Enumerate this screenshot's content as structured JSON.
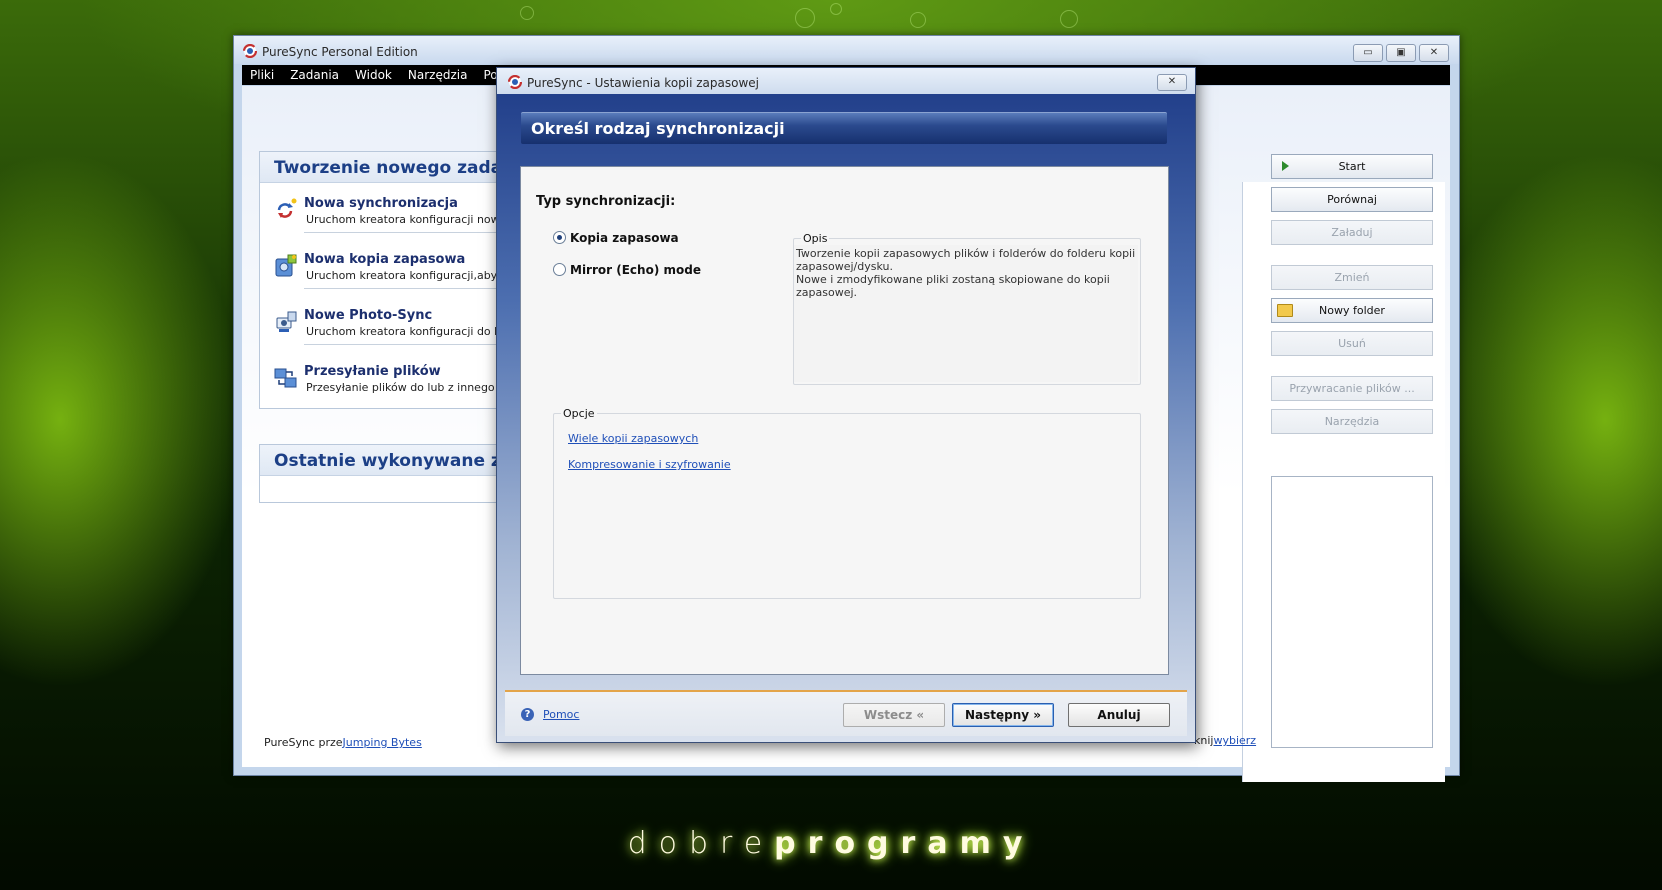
{
  "main_window": {
    "title": "PureSync Personal Edition",
    "menu": [
      "Pliki",
      "Zadania",
      "Widok",
      "Narzędzia",
      "Pomoc"
    ],
    "controls": {
      "minimize": "▭",
      "restore": "▣",
      "close": "✕"
    }
  },
  "create_panel": {
    "title": "Tworzenie nowego zadania",
    "tasks": [
      {
        "title": "Nowa synchronizacja",
        "desc": "Uruchom kreatora konfiguracji nowej sy"
      },
      {
        "title": "Nowa kopia zapasowa",
        "desc": "Uruchom kreatora konfiguracji,aby sko"
      },
      {
        "title": "Nowe Photo-Sync",
        "desc": "Uruchom kreatora konfiguracji do kopio"
      },
      {
        "title": "Przesyłanie plików",
        "desc": "Przesyłanie plików do lub z innego kom"
      }
    ]
  },
  "recent_panel": {
    "title": "Ostatnie wykonywane zada"
  },
  "side_buttons": [
    {
      "label": "Start",
      "enabled": true
    },
    {
      "label": "Porównaj",
      "enabled": true
    },
    {
      "label": "Załaduj",
      "enabled": false
    },
    {
      "label": "Zmień",
      "enabled": false
    },
    {
      "label": "Nowy folder",
      "enabled": true
    },
    {
      "label": "Usuń",
      "enabled": false
    },
    {
      "label": "Przywracanie plików ...",
      "enabled": false
    },
    {
      "label": "Narzędzia",
      "enabled": false
    }
  ],
  "footer": {
    "prefix": "PureSync prze",
    "company_link": "Jumping Bytes",
    "right_text": "knij",
    "right_link": "wybierz"
  },
  "dialog": {
    "title": "PureSync - Ustawienia kopii zapasowej",
    "close": "✕",
    "header": "Określ rodzaj synchronizacji",
    "sync_type_label": "Typ synchronizacji:",
    "options": [
      {
        "label": "Kopia zapasowa",
        "selected": true
      },
      {
        "label": "Mirror (Echo) mode",
        "selected": false
      }
    ],
    "description": {
      "legend": "Opis",
      "line1": "Tworzenie kopii zapasowych plików i folderów do folderu kopii",
      "line2": "zapasowej/dysku.",
      "line3": "Nowe i zmodyfikowane pliki zostaną skopiowane do kopii zapasowej."
    },
    "opcje": {
      "legend": "Opcje",
      "links": [
        "Wiele kopii zapasowych",
        "Kompresowanie i szyfrowanie"
      ]
    },
    "help_icon": "?",
    "help_link": "Pomoc",
    "buttons": {
      "back": "Wstecz «",
      "next": "Następny »",
      "cancel": "Anuluj"
    }
  },
  "wallpaper": {
    "brand_light": "dobre",
    "brand_bold": "programy"
  },
  "colors": {
    "accent": "#1c3f86",
    "link": "#1f4fb8",
    "header_dark": "#16306e"
  }
}
